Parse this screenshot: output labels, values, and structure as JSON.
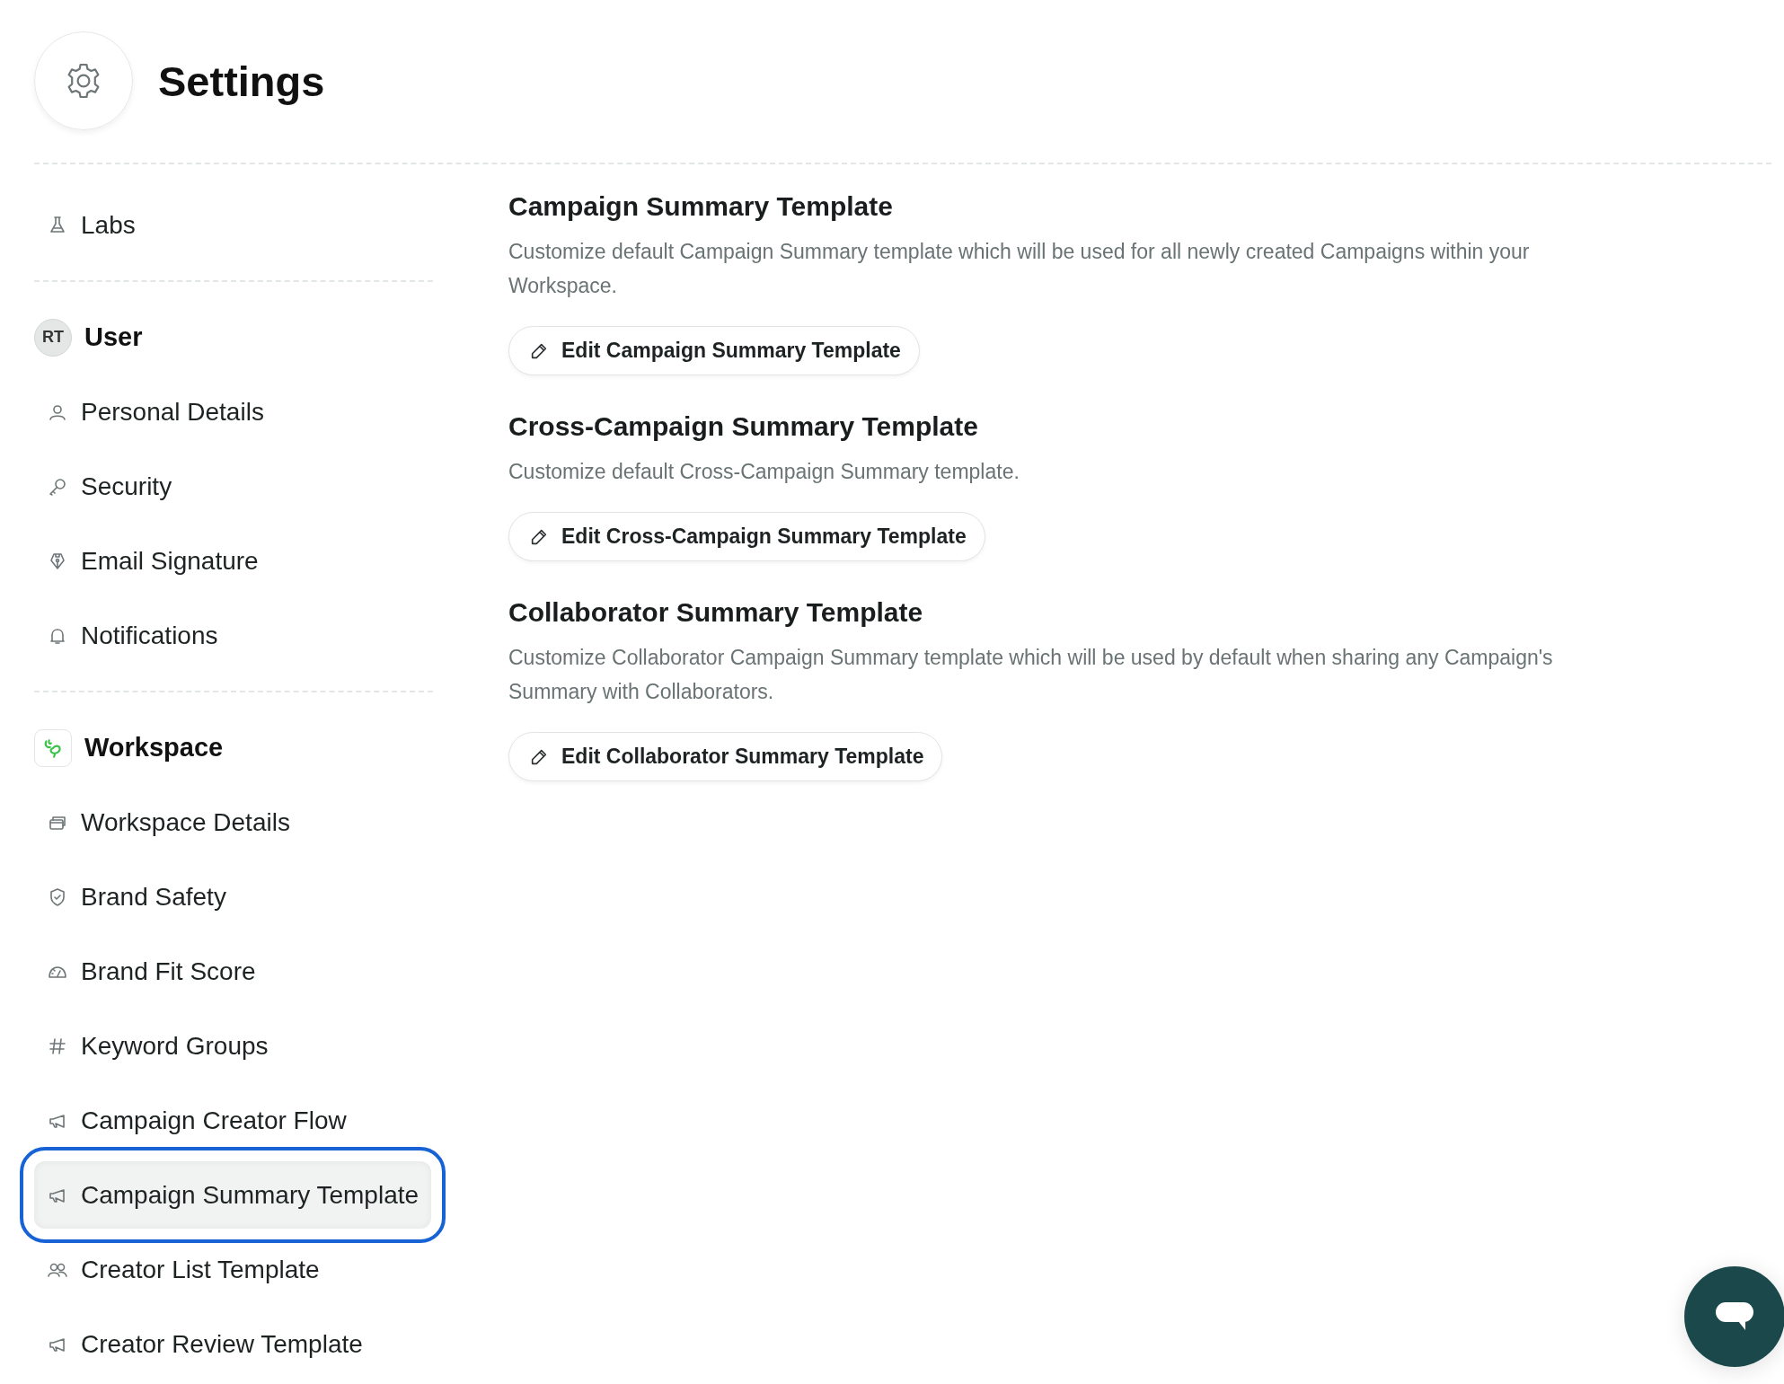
{
  "header": {
    "title": "Settings"
  },
  "sidebar": {
    "groups": [
      {
        "items": [
          {
            "label": "Labs",
            "selected": false
          }
        ]
      },
      {
        "heading": {
          "label": "User",
          "kind": "initials",
          "initials": "RT"
        },
        "items": [
          {
            "label": "Personal Details",
            "selected": false
          },
          {
            "label": "Security",
            "selected": false
          },
          {
            "label": "Email Signature",
            "selected": false
          },
          {
            "label": "Notifications",
            "selected": false
          }
        ]
      },
      {
        "heading": {
          "label": "Workspace",
          "kind": "logo"
        },
        "items": [
          {
            "label": "Workspace Details",
            "selected": false
          },
          {
            "label": "Brand Safety",
            "selected": false
          },
          {
            "label": "Brand Fit Score",
            "selected": false
          },
          {
            "label": "Keyword Groups",
            "selected": false
          },
          {
            "label": "Campaign Creator Flow",
            "selected": false
          },
          {
            "label": "Campaign Summary Template",
            "selected": true
          },
          {
            "label": "Creator List Template",
            "selected": false
          },
          {
            "label": "Creator Review Template",
            "selected": false
          }
        ]
      }
    ]
  },
  "sections": [
    {
      "title": "Campaign Summary Template",
      "description": "Customize default Campaign Summary template which will be used for all newly created Campaigns within your Workspace.",
      "button": "Edit Campaign Summary Template"
    },
    {
      "title": "Cross-Campaign Summary Template",
      "description": "Customize default Cross-Campaign Summary template.",
      "button": "Edit Cross-Campaign Summary Template"
    },
    {
      "title": "Collaborator Summary Template",
      "description": "Customize Collaborator Campaign Summary template which will be used by default when sharing any Campaign's Summary with Collaborators.",
      "button": "Edit Collaborator Summary Template"
    }
  ]
}
